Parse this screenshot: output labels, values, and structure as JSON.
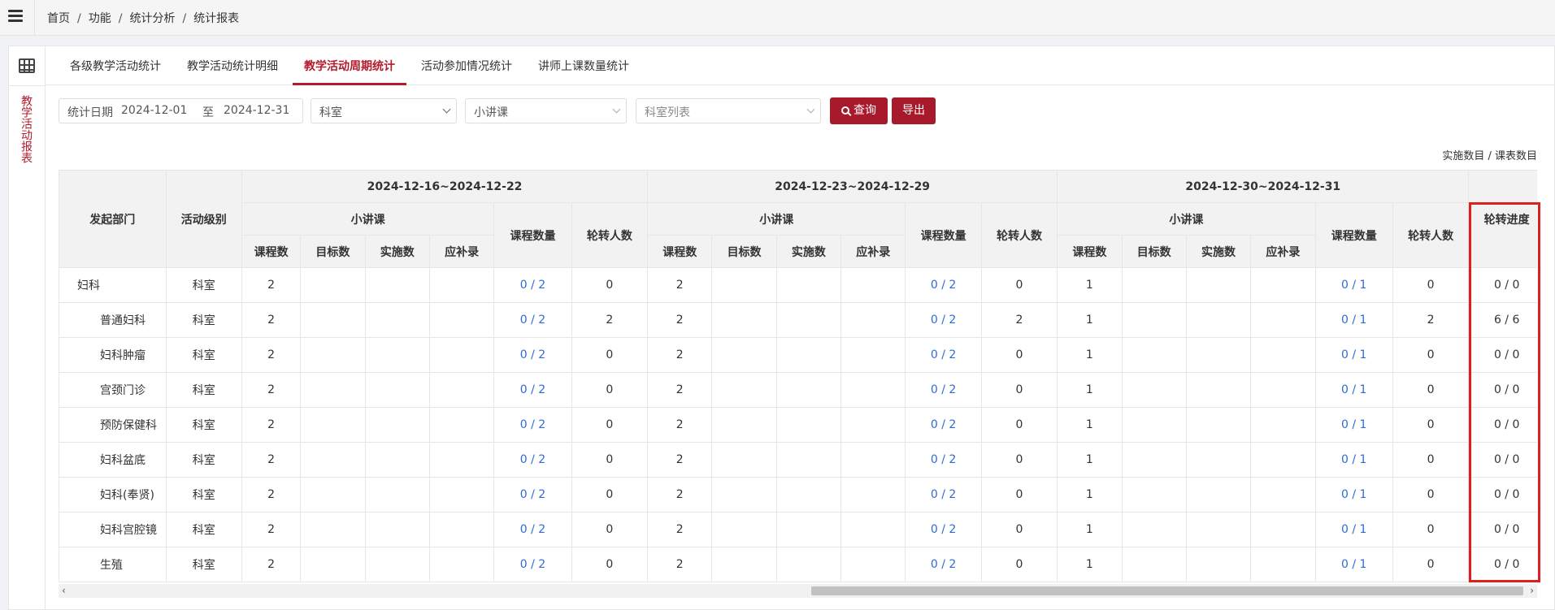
{
  "breadcrumb": [
    "首页",
    "功能",
    "统计分析",
    "统计报表"
  ],
  "side_title": "教学活动报表",
  "tabs": [
    "各级教学活动统计",
    "教学活动统计明细",
    "教学活动周期统计",
    "活动参加情况统计",
    "讲师上课数量统计"
  ],
  "active_tab": 2,
  "filters": {
    "date_label": "统计日期",
    "date_from": "2024-12-01",
    "date_to_label": "至",
    "date_to": "2024-12-31",
    "dept_select": "科室",
    "type_select": "小讲课",
    "room_placeholder": "科室列表",
    "search_label": "查询",
    "export_label": "导出"
  },
  "legend_note": "实施数目 / 课表数目",
  "table": {
    "col_dept": "发起部门",
    "col_level": "活动级别",
    "periods": [
      "2024-12-16~2024-12-22",
      "2024-12-23~2024-12-29",
      "2024-12-30~2024-12-31"
    ],
    "sub_group": "小讲课",
    "sub_cols": [
      "课程数",
      "目标数",
      "实施数",
      "应补录"
    ],
    "col_course_qty": "课程数量",
    "col_rotation": "轮转人数",
    "col_progress": "轮转进度",
    "rows": [
      {
        "dept": "妇科",
        "level": "科室",
        "sub": false,
        "p": [
          [
            "2",
            "",
            "",
            "",
            "0 / 2",
            "0"
          ],
          [
            "2",
            "",
            "",
            "",
            "0 / 2",
            "0"
          ],
          [
            "1",
            "",
            "",
            "",
            "0 / 1",
            "0"
          ]
        ],
        "progress": "0 / 0"
      },
      {
        "dept": "普通妇科",
        "level": "科室",
        "sub": true,
        "p": [
          [
            "2",
            "",
            "",
            "",
            "0 / 2",
            "2"
          ],
          [
            "2",
            "",
            "",
            "",
            "0 / 2",
            "2"
          ],
          [
            "1",
            "",
            "",
            "",
            "0 / 1",
            "2"
          ]
        ],
        "progress": "6 / 6"
      },
      {
        "dept": "妇科肿瘤",
        "level": "科室",
        "sub": true,
        "p": [
          [
            "2",
            "",
            "",
            "",
            "0 / 2",
            "0"
          ],
          [
            "2",
            "",
            "",
            "",
            "0 / 2",
            "0"
          ],
          [
            "1",
            "",
            "",
            "",
            "0 / 1",
            "0"
          ]
        ],
        "progress": "0 / 0"
      },
      {
        "dept": "宫颈门诊",
        "level": "科室",
        "sub": true,
        "p": [
          [
            "2",
            "",
            "",
            "",
            "0 / 2",
            "0"
          ],
          [
            "2",
            "",
            "",
            "",
            "0 / 2",
            "0"
          ],
          [
            "1",
            "",
            "",
            "",
            "0 / 1",
            "0"
          ]
        ],
        "progress": "0 / 0"
      },
      {
        "dept": "预防保健科",
        "level": "科室",
        "sub": true,
        "p": [
          [
            "2",
            "",
            "",
            "",
            "0 / 2",
            "0"
          ],
          [
            "2",
            "",
            "",
            "",
            "0 / 2",
            "0"
          ],
          [
            "1",
            "",
            "",
            "",
            "0 / 1",
            "0"
          ]
        ],
        "progress": "0 / 0"
      },
      {
        "dept": "妇科盆底",
        "level": "科室",
        "sub": true,
        "p": [
          [
            "2",
            "",
            "",
            "",
            "0 / 2",
            "0"
          ],
          [
            "2",
            "",
            "",
            "",
            "0 / 2",
            "0"
          ],
          [
            "1",
            "",
            "",
            "",
            "0 / 1",
            "0"
          ]
        ],
        "progress": "0 / 0"
      },
      {
        "dept": "妇科(奉贤)",
        "level": "科室",
        "sub": true,
        "p": [
          [
            "2",
            "",
            "",
            "",
            "0 / 2",
            "0"
          ],
          [
            "2",
            "",
            "",
            "",
            "0 / 2",
            "0"
          ],
          [
            "1",
            "",
            "",
            "",
            "0 / 1",
            "0"
          ]
        ],
        "progress": "0 / 0"
      },
      {
        "dept": "妇科宫腔镜",
        "level": "科室",
        "sub": true,
        "p": [
          [
            "2",
            "",
            "",
            "",
            "0 / 2",
            "0"
          ],
          [
            "2",
            "",
            "",
            "",
            "0 / 2",
            "0"
          ],
          [
            "1",
            "",
            "",
            "",
            "0 / 1",
            "0"
          ]
        ],
        "progress": "0 / 0"
      },
      {
        "dept": "生殖",
        "level": "科室",
        "sub": true,
        "p": [
          [
            "2",
            "",
            "",
            "",
            "0 / 2",
            "0"
          ],
          [
            "2",
            "",
            "",
            "",
            "0 / 2",
            "0"
          ],
          [
            "1",
            "",
            "",
            "",
            "0 / 1",
            "0"
          ]
        ],
        "progress": "0 / 0"
      }
    ]
  },
  "colors": {
    "accent": "#a8192b",
    "link": "#2f6bd6",
    "highlight_box": "#e01e1e"
  }
}
